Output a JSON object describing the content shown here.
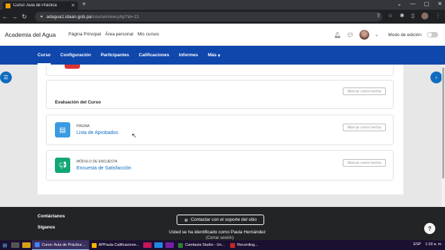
{
  "browser": {
    "tab_title": "Curso: Aula de Práctica",
    "new_tab": "+",
    "url_domain": "adagua1.idaan.gob.pa",
    "url_path": "/course/view.php?id=13"
  },
  "site": {
    "brand": "Academia del Agua",
    "links": [
      "Página Principal",
      "Área personal",
      "Mis cursos"
    ],
    "edit_mode": "Modo de edición"
  },
  "course_nav": {
    "items": [
      "Curso",
      "Configuración",
      "Participantes",
      "Calificaciones",
      "Informes",
      "Más"
    ],
    "more_caret": "▾"
  },
  "content": {
    "mark_done": "Marcar como hecha",
    "section_title": "Evaluación del Curso",
    "activities": [
      {
        "type": "PÁGINA",
        "name": "Lista de Aprobados",
        "icon": "page-icon",
        "color": "#399be2"
      },
      {
        "type": "MÓDULO DE ENCUESTA",
        "name": "Encuesta de Satisfacción",
        "icon": "megaphone-icon",
        "color": "#11a676"
      }
    ]
  },
  "footer": {
    "contact": "Contáctanos",
    "follow": "Síganos",
    "support_button": "Contactar con el soporte del sitio",
    "logged_in": "Usted se ha identificado como Paula Hernández",
    "logout": "(Cerrar sesión)",
    "help": "?"
  },
  "taskbar": {
    "items": [
      {
        "label": "Curso: Aula de Práctica ...",
        "color": "#4285f4",
        "active": true
      },
      {
        "label": "APPaula Calificacione...",
        "color": "#f4b400",
        "active": false
      },
      {
        "label": "Camtasia Studio - Un...",
        "color": "#2e7d32",
        "active": false
      },
      {
        "label": "Recording...",
        "color": "#c62828",
        "active": false
      }
    ],
    "lang": "ESP",
    "time": "1:18 a. m."
  }
}
